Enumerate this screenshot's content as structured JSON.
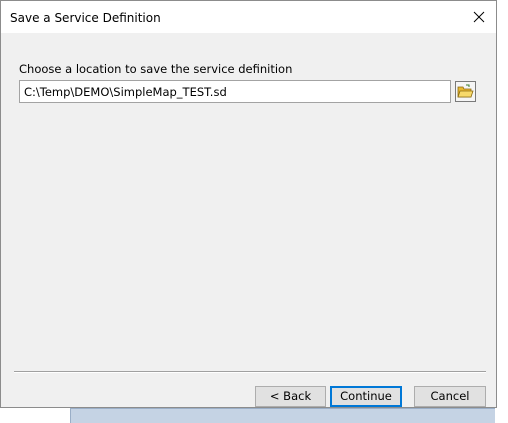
{
  "window": {
    "title": "Save a Service Definition"
  },
  "form": {
    "prompt_label": "Choose a location to save the service definition",
    "path_value": "C:\\Temp\\DEMO\\SimpleMap_TEST.sd"
  },
  "icons": {
    "close": "close-icon",
    "browse": "open-folder-icon"
  },
  "buttons": {
    "back_label": "< Back",
    "continue_label": "Continue",
    "cancel_label": "Cancel"
  },
  "colors": {
    "focus_border": "#0078d7",
    "window_background": "#f0f0f0",
    "folder_yellow": "#f3c944"
  }
}
